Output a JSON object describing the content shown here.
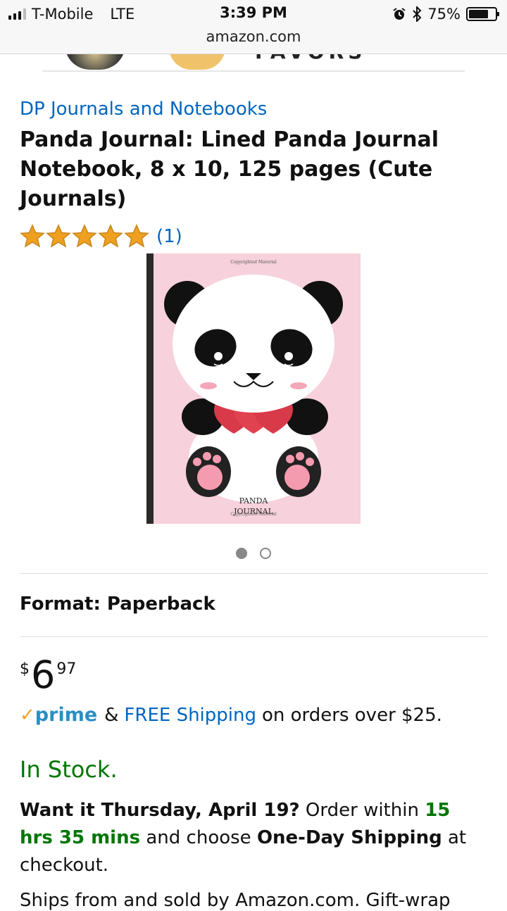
{
  "status_bar": {
    "carrier": "T-Mobile",
    "network": "LTE",
    "time": "3:39 PM",
    "url": "amazon.com",
    "battery": "75%",
    "battery_level": 0.75,
    "signal_bars_on": 3,
    "signal_bars_total": 4
  },
  "peek": {
    "partial_text": "FAVORS"
  },
  "product": {
    "brand": "DP Journals and Notebooks",
    "title": "Panda Journal: Lined Panda Journal Notebook, 8 x 10, 125 pages (Cute Journals)",
    "rating_stars": 5,
    "review_count": "(1)",
    "cover": {
      "copyright_top": "Copyrighted Material",
      "cover_title_line1": "PANDA",
      "cover_title_line2": "JOURNAL",
      "copyright_bottom": "Copyrighted Material",
      "background_color": "#f7d1db"
    },
    "carousel": {
      "count": 2,
      "active_index": 0
    },
    "format_label": "Format: Paperback",
    "price": {
      "currency": "$",
      "whole": "6",
      "fraction": "97"
    },
    "shipping": {
      "prime_check": "✓",
      "prime_word": "prime",
      "amp": "&",
      "free_shipping": "FREE Shipping",
      "condition": "on orders over $25."
    },
    "stock": "In Stock.",
    "delivery": {
      "want_it": "Want it Thursday, April 19?",
      "order_within": "Order within",
      "time_left": "15 hrs 35 mins",
      "and_choose": "and choose",
      "option": "One-Day Shipping",
      "at_checkout": "at checkout."
    },
    "ships_from": "Ships from and sold by Amazon.com. Gift-wrap"
  },
  "colors": {
    "link": "#0066c0",
    "in_stock": "#007600",
    "star": "#f0a020",
    "prime": "#2a8fc5"
  }
}
